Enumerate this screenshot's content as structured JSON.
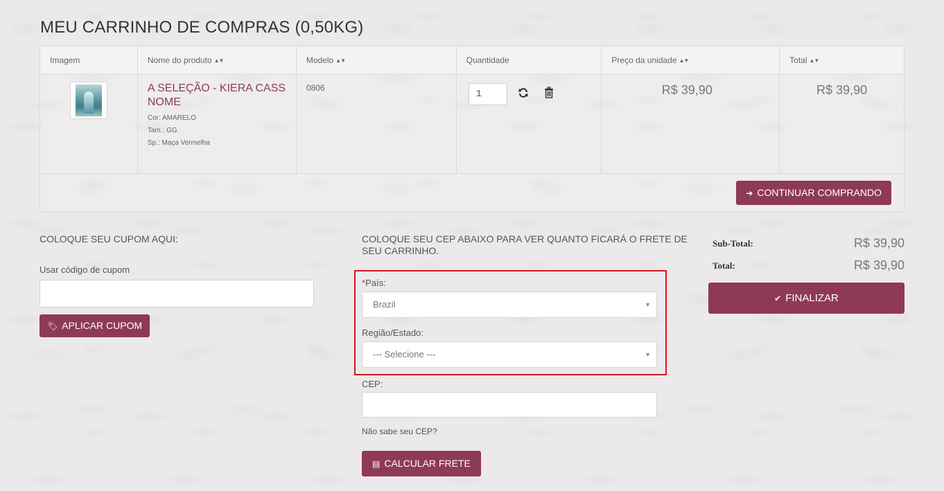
{
  "page": {
    "title": "MEU CARRINHO DE COMPRAS",
    "weight": " (0,50KG)"
  },
  "table": {
    "headers": {
      "image": "Imagem",
      "name": "Nome do produto",
      "model": "Modelo",
      "quantity": "Quantidade",
      "unit_price": "Preço da unidade",
      "total": "Total"
    },
    "rows": [
      {
        "name": "A SELEÇÃO - KIERA CASS NOME",
        "options": [
          "Cor: AMARELO",
          "Tam.: GG",
          "Sp.: Maça Vermelha"
        ],
        "model": "0806",
        "quantity": "1",
        "unit_price": "R$ 39,90",
        "total": "R$ 39,90"
      }
    ],
    "continue_label": "CONTINUAR COMPRANDO"
  },
  "coupon": {
    "heading": "COLOQUE SEU CUPOM AQUI:",
    "label": "Usar código de cupom",
    "value": "",
    "button": "APLICAR CUPOM"
  },
  "shipping": {
    "heading": "COLOQUE SEU CEP ABAIXO PARA VER QUANTO FICARÁ O FRETE DE SEU CARRINHO.",
    "country_required": "*",
    "country_label": "País:",
    "country_value": "Brazil",
    "region_label": "Região/Estado:",
    "region_value": "--- Selecione ---",
    "cep_label": "CEP:",
    "cep_value": "",
    "help_text": "Não sabe seu CEP?",
    "button": "CALCULAR FRETE"
  },
  "totals": {
    "subtotal_label": "Sub-Total:",
    "subtotal_value": "R$ 39,90",
    "total_label": "Total:",
    "total_value": "R$ 39,90",
    "finalize": "FINALIZAR"
  },
  "colors": {
    "accent": "#8f3a54",
    "product_link": "#8c3b52",
    "highlight": "#d0181e"
  },
  "icons": {
    "sort": "sort-icon",
    "refresh": "refresh-icon",
    "trash": "trash-icon",
    "arrow": "arrow-right-icon",
    "tag": "tag-icon",
    "document": "document-icon",
    "check": "check-icon"
  }
}
